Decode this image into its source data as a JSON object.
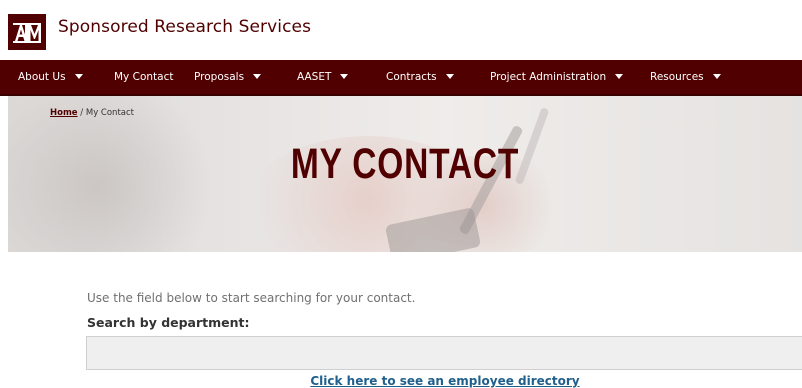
{
  "header": {
    "logo_alt": "ATM",
    "site_title": "Sponsored Research Services"
  },
  "nav": {
    "items": [
      {
        "label": "About Us",
        "has_dropdown": true
      },
      {
        "label": "My Contact",
        "has_dropdown": false
      },
      {
        "label": "Proposals",
        "has_dropdown": true
      },
      {
        "label": "AASET",
        "has_dropdown": true
      },
      {
        "label": "Contracts",
        "has_dropdown": true
      },
      {
        "label": "Project Administration",
        "has_dropdown": true
      },
      {
        "label": "Resources",
        "has_dropdown": true
      }
    ]
  },
  "hero": {
    "breadcrumb_home": "Home",
    "breadcrumb_sep": "/",
    "breadcrumb_current": "My Contact",
    "title": "MY CONTACT"
  },
  "content": {
    "intro": "Use the field below to start searching for your contact.",
    "search_label": "Search by department:",
    "search_value": "",
    "directory_link": "Click here to see an employee directory"
  },
  "colors": {
    "brand": "#500000",
    "link": "#1f5f8b"
  }
}
